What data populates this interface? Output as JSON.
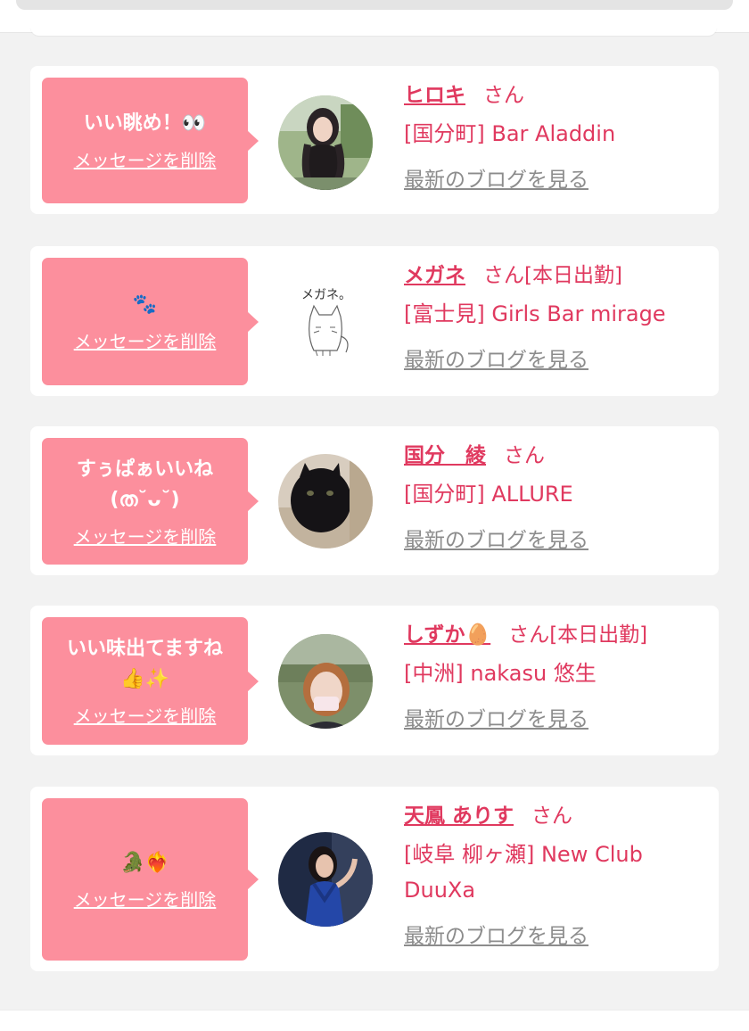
{
  "cards": [
    {
      "message": "いい眺め！👀",
      "delete_label": "メッセージを削除",
      "name": "ヒロキ",
      "san": "さん",
      "status": "",
      "shop": "[国分町] Bar Aladdin",
      "blog_label": "最新のブログを見る"
    },
    {
      "message": "🐾",
      "delete_label": "メッセージを削除",
      "name": "メガネ",
      "san": "さん",
      "status": "[本日出勤]",
      "shop": "[富士見] Girls Bar mirage",
      "blog_label": "最新のブログを見る",
      "avatar_text": "メガネ。"
    },
    {
      "message": "すぅぱぁいいね\n(ത˘ᴗ˘)",
      "delete_label": "メッセージを削除",
      "name": "国分　綾",
      "san": "さん",
      "status": "",
      "shop": "[国分町] ALLURE",
      "blog_label": "最新のブログを見る"
    },
    {
      "message": "いい味出てますね\n👍✨",
      "delete_label": "メッセージを削除",
      "name": "しずか🥚",
      "san": "さん",
      "status": "[本日出勤]",
      "shop": "[中洲] nakasu 悠生",
      "blog_label": "最新のブログを見る"
    },
    {
      "message": "🐊❤️‍🔥",
      "delete_label": "メッセージを削除",
      "name": "天鳳 ありす",
      "san": "さん",
      "status": "",
      "shop": "[岐阜 柳ヶ瀬] New Club DuuXa",
      "blog_label": "最新のブログを見る"
    }
  ],
  "colors": {
    "bubble": "#fc8f9d",
    "accent_text": "#e0395f",
    "link_gray": "#8c8c8c",
    "background": "#f2f2f2"
  }
}
